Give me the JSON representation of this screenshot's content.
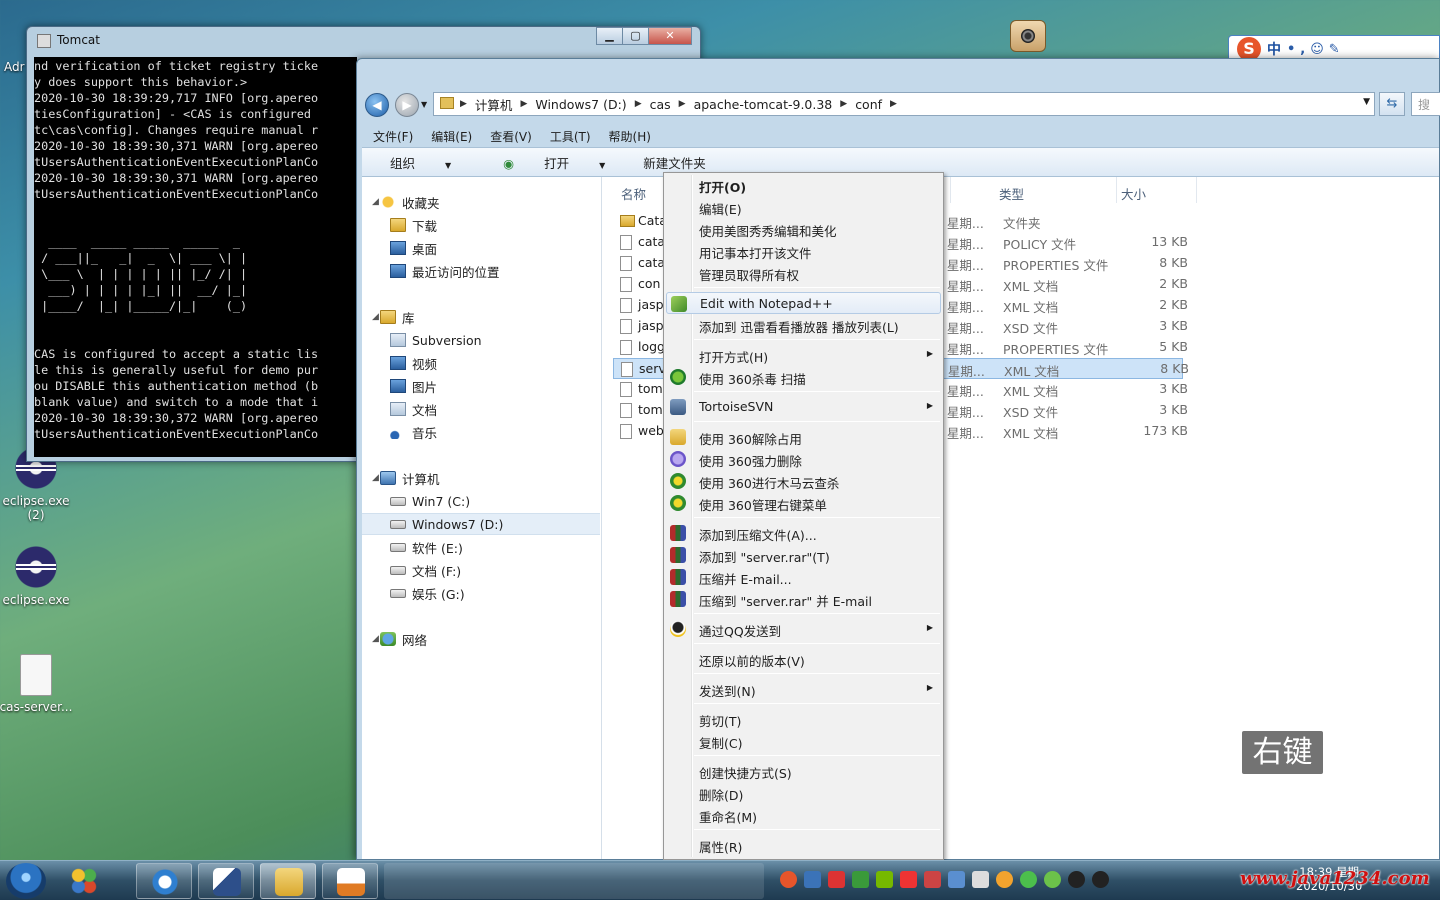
{
  "desktop": {
    "top_left_label": "Adr",
    "icons": [
      {
        "label": "eclipse.exe",
        "sub": "(2)"
      },
      {
        "label": "eclipse.exe",
        "sub": ""
      },
      {
        "label": "cas-server...",
        "sub": ""
      }
    ]
  },
  "console": {
    "title": "Tomcat",
    "lines": [
      "nd verification of ticket registry ticke",
      "y does support this behavior.>",
      "2020-10-30 18:39:29,717 INFO [org.apereo",
      "tiesConfiguration] - <CAS is configured",
      "tc\\cas\\config]. Changes require manual r",
      "2020-10-30 18:39:30,371 WARN [org.apereo",
      "tUsersAuthenticationEventExecutionPlanCo",
      "2020-10-30 18:39:30,371 WARN [org.apereo",
      "tUsersAuthenticationEventExecutionPlanCo",
      "",
      "",
      "  ____  _____ _____  _____  _",
      " / ___||_   _|  _  \\| ___ \\| |",
      " \\___ \\  | | | | | || |_/ /| |",
      "  ___) | | | | |_| ||  __/ |_|",
      " |____/  |_| |_____/|_|    (_)",
      "",
      "",
      "CAS is configured to accept a static lis",
      "le this is generally useful for demo pur",
      "ou DISABLE this authentication method (b",
      "blank value) and switch to a mode that i",
      "2020-10-30 18:39:30,372 WARN [org.apereo",
      "tUsersAuthenticationEventExecutionPlanCo"
    ]
  },
  "explorer": {
    "breadcrumb": [
      "计算机",
      "Windows7 (D:)",
      "cas",
      "apache-tomcat-9.0.38",
      "conf"
    ],
    "search_placeholder": "搜",
    "menus": [
      "文件(F)",
      "编辑(E)",
      "查看(V)",
      "工具(T)",
      "帮助(H)"
    ],
    "toolbar": {
      "organize": "组织",
      "open": "打开",
      "new_folder": "新建文件夹"
    },
    "nav": [
      {
        "label": "收藏夹",
        "icon": "star",
        "level": 0
      },
      {
        "label": "下载",
        "icon": "folder",
        "level": 1
      },
      {
        "label": "桌面",
        "icon": "blue",
        "level": 1
      },
      {
        "label": "最近访问的位置",
        "icon": "blue",
        "level": 1
      },
      {
        "label": "库",
        "icon": "folder",
        "level": 0
      },
      {
        "label": "Subversion",
        "icon": "svn",
        "level": 1
      },
      {
        "label": "视频",
        "icon": "blue",
        "level": 1
      },
      {
        "label": "图片",
        "icon": "blue",
        "level": 1
      },
      {
        "label": "文档",
        "icon": "svn",
        "level": 1
      },
      {
        "label": "音乐",
        "icon": "music",
        "level": 1
      },
      {
        "label": "计算机",
        "icon": "comp",
        "level": 0
      },
      {
        "label": "Win7 (C:)",
        "icon": "drive",
        "level": 1
      },
      {
        "label": "Windows7 (D:)",
        "icon": "drive",
        "level": 1
      },
      {
        "label": "软件 (E:)",
        "icon": "drive",
        "level": 1
      },
      {
        "label": "文档 (F:)",
        "icon": "drive",
        "level": 1
      },
      {
        "label": "娱乐 (G:)",
        "icon": "drive",
        "level": 1
      },
      {
        "label": "网络",
        "icon": "net",
        "level": 0
      }
    ],
    "columns": {
      "name": "名称",
      "type": "类型",
      "size": "大小"
    },
    "files": [
      {
        "name": "Cata",
        "date": "5 星期...",
        "type": "文件夹",
        "size": "",
        "folder": true
      },
      {
        "name": "cata",
        "date": "5 星期...",
        "type": "POLICY 文件",
        "size": "13 KB"
      },
      {
        "name": "cata",
        "date": "5 星期...",
        "type": "PROPERTIES 文件",
        "size": "8 KB"
      },
      {
        "name": "con",
        "date": "5 星期...",
        "type": "XML 文档",
        "size": "2 KB"
      },
      {
        "name": "jasp",
        "date": "5 星期...",
        "type": "XML 文档",
        "size": "2 KB"
      },
      {
        "name": "jasp",
        "date": "5 星期...",
        "type": "XSD 文件",
        "size": "3 KB"
      },
      {
        "name": "logg",
        "date": "5 星期...",
        "type": "PROPERTIES 文件",
        "size": "5 KB"
      },
      {
        "name": "serv",
        "date": "5 星期...",
        "type": "XML 文档",
        "size": "8 KB",
        "selected": true
      },
      {
        "name": "tom",
        "date": "5 星期...",
        "type": "XML 文档",
        "size": "3 KB"
      },
      {
        "name": "tom",
        "date": "5 星期...",
        "type": "XSD 文件",
        "size": "3 KB"
      },
      {
        "name": "web",
        "date": "5 星期...",
        "type": "XML 文档",
        "size": "173 KB"
      }
    ]
  },
  "context_menu": {
    "items": [
      {
        "label": "打开(O)",
        "bold": true
      },
      {
        "label": "编辑(E)"
      },
      {
        "label": "使用美图秀秀编辑和美化"
      },
      {
        "label": "用记事本打开该文件"
      },
      {
        "label": "管理员取得所有权"
      },
      {
        "sep": true
      },
      {
        "label": "Edit with Notepad++",
        "icon": "np",
        "hover": true
      },
      {
        "label": "添加到 迅雷看看播放器 播放列表(L)"
      },
      {
        "sep": true
      },
      {
        "label": "打开方式(H)",
        "submenu": true
      },
      {
        "label": "使用 360杀毒 扫描",
        "icon": "360"
      },
      {
        "sep": true
      },
      {
        "label": "TortoiseSVN",
        "icon": "svn",
        "submenu": true
      },
      {
        "sep": true
      },
      {
        "label": "使用 360解除占用",
        "icon": "folder"
      },
      {
        "label": "使用 360强力删除",
        "icon": "del"
      },
      {
        "label": "使用 360进行木马云查杀",
        "icon": "360b"
      },
      {
        "label": "使用 360管理右键菜单",
        "icon": "360b"
      },
      {
        "sep": true
      },
      {
        "label": "添加到压缩文件(A)...",
        "icon": "rar"
      },
      {
        "label": "添加到 \"server.rar\"(T)",
        "icon": "rar"
      },
      {
        "label": "压缩并 E-mail...",
        "icon": "rar"
      },
      {
        "label": "压缩到 \"server.rar\" 并 E-mail",
        "icon": "rar"
      },
      {
        "sep": true
      },
      {
        "label": "通过QQ发送到",
        "icon": "qq",
        "submenu": true
      },
      {
        "sep": true
      },
      {
        "label": "还原以前的版本(V)"
      },
      {
        "sep": true
      },
      {
        "label": "发送到(N)",
        "submenu": true
      },
      {
        "sep": true
      },
      {
        "label": "剪切(T)"
      },
      {
        "label": "复制(C)"
      },
      {
        "sep": true
      },
      {
        "label": "创建快捷方式(S)"
      },
      {
        "label": "删除(D)"
      },
      {
        "label": "重命名(M)"
      },
      {
        "sep": true
      },
      {
        "label": "属性(R)"
      }
    ]
  },
  "overlay_label": "右键",
  "ime": {
    "logo": "S",
    "mode": "中",
    "dots": "•,☺✎"
  },
  "taskbar": {
    "clock_time": "18:39 星期",
    "clock_date": "2020/10/30"
  },
  "watermark": "www.java1234.com"
}
